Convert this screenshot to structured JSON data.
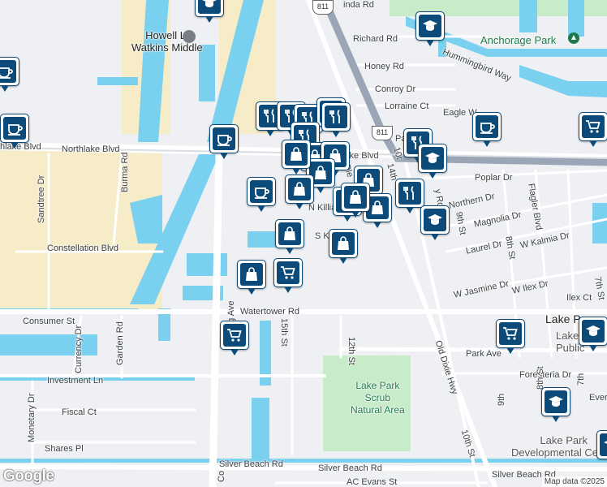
{
  "map": {
    "attribution": "Map data ©2025",
    "logo": "Google",
    "route_shield": "811",
    "colors": {
      "water": "#7ad0ef",
      "park": "#c8ebc9",
      "road": "#ffffff",
      "highway": "#9aa6b5",
      "pin": "#0b4a79",
      "sand": "#f6ecc8"
    }
  },
  "streets": [
    {
      "key": "richard",
      "text": "Richard Rd"
    },
    {
      "key": "honey",
      "text": "Honey Rd"
    },
    {
      "key": "conroy",
      "text": "Conroy Dr"
    },
    {
      "key": "lorraine",
      "text": "Lorraine Ct"
    },
    {
      "key": "eagle",
      "text": "Eagle W"
    },
    {
      "key": "hummingbird",
      "text": "Hummingbird Way"
    },
    {
      "key": "northlake_w",
      "text": "hlake Blvd"
    },
    {
      "key": "northlake_c",
      "text": "Northlake Blvd"
    },
    {
      "key": "northlake_e",
      "text": "lake Blvd"
    },
    {
      "key": "poplar",
      "text": "Poplar Dr"
    },
    {
      "key": "northern",
      "text": "Northern Dr"
    },
    {
      "key": "magnolia",
      "text": "Magnolia Dr"
    },
    {
      "key": "laurel",
      "text": "Laurel Dr"
    },
    {
      "key": "kalmia",
      "text": "W Kalmia Dr"
    },
    {
      "key": "jasmine",
      "text": "W Jasmine Dr"
    },
    {
      "key": "ilex",
      "text": "W Ilex Dr"
    },
    {
      "key": "ilexct",
      "text": "Ilex Ct"
    },
    {
      "key": "killian",
      "text": "N Killia"
    },
    {
      "key": "sk",
      "text": "S K"
    },
    {
      "key": "constellation",
      "text": "Constellation Blvd"
    },
    {
      "key": "consumer",
      "text": "Consumer St"
    },
    {
      "key": "watertower",
      "text": "Watertower Rd"
    },
    {
      "key": "investment",
      "text": "Investment Ln"
    },
    {
      "key": "fiscal",
      "text": "Fiscal Ct"
    },
    {
      "key": "shares",
      "text": "Shares Pl"
    },
    {
      "key": "silver_w",
      "text": "Silver Beach Rd"
    },
    {
      "key": "silver_c",
      "text": "Silver Beach Rd"
    },
    {
      "key": "silver_e",
      "text": "Silver Beach Rd"
    },
    {
      "key": "acevans",
      "text": "AC Evans St"
    },
    {
      "key": "park",
      "text": "Park Ave"
    },
    {
      "key": "foresteria",
      "text": "Foresteria Dr"
    },
    {
      "key": "sandtree",
      "text": "Sandtree Dr"
    },
    {
      "key": "burma",
      "text": "Burma Rd"
    },
    {
      "key": "currency",
      "text": "Currency Dr"
    },
    {
      "key": "garden",
      "text": "Garden Rd"
    },
    {
      "key": "monetary",
      "text": "Monetary Dr"
    },
    {
      "key": "cong",
      "text": "Cong Ave"
    },
    {
      "key": "cong2",
      "text": "Co"
    },
    {
      "key": "fifteenth",
      "text": "15th St"
    },
    {
      "key": "twelfth",
      "text": "12th St"
    },
    {
      "key": "olddixie",
      "text": "Old Dixie Hwy"
    },
    {
      "key": "tenth",
      "text": "10th St"
    },
    {
      "key": "ninth",
      "text": "9th St"
    },
    {
      "key": "eighth",
      "text": "8th St"
    },
    {
      "key": "flagler",
      "text": "Flagler Blvd"
    },
    {
      "key": "seventh",
      "text": "7th St"
    },
    {
      "key": "nine2",
      "text": "9th"
    },
    {
      "key": "eight2",
      "text": "8th St"
    },
    {
      "key": "seven2",
      "text": "7th"
    },
    {
      "key": "inda",
      "text": "inda Rd"
    },
    {
      "key": "pa",
      "text": "Pa"
    },
    {
      "key": "ole",
      "text": "Ole"
    },
    {
      "key": "tenth2",
      "text": "10t"
    },
    {
      "key": "st14",
      "text": "14th"
    },
    {
      "key": "evers",
      "text": "Ever"
    },
    {
      "key": "yrd",
      "text": "y Rd"
    }
  ],
  "places": [
    {
      "key": "watkins",
      "text": "Howell L.\nWatkins Middle"
    },
    {
      "key": "anchorage",
      "text": "Anchorage Park"
    },
    {
      "key": "scrub",
      "text": "Lake Park\nScrub\nNatural Area"
    },
    {
      "key": "lakepark",
      "text": "Lake P"
    },
    {
      "key": "library",
      "text": "Lake\nPublic"
    },
    {
      "key": "devcenter",
      "text": "Lake Park\nDevelopmental Center"
    }
  ],
  "markers": [
    {
      "type": "coffee"
    },
    {
      "type": "school"
    },
    {
      "type": "school"
    },
    {
      "type": "coffee"
    },
    {
      "type": "cart"
    },
    {
      "type": "coffee"
    },
    {
      "type": "restaurant"
    },
    {
      "type": "restaurant"
    },
    {
      "type": "restaurant"
    },
    {
      "type": "restaurant"
    },
    {
      "type": "restaurant"
    },
    {
      "type": "restaurant"
    },
    {
      "type": "restaurant"
    },
    {
      "type": "school"
    },
    {
      "type": "coffee"
    },
    {
      "type": "bag"
    },
    {
      "type": "bag"
    },
    {
      "type": "bag"
    },
    {
      "type": "bag"
    },
    {
      "type": "bag"
    },
    {
      "type": "coffee"
    },
    {
      "type": "bag"
    },
    {
      "type": "bag"
    },
    {
      "type": "bag"
    },
    {
      "type": "restaurant"
    },
    {
      "type": "school"
    },
    {
      "type": "bag"
    },
    {
      "type": "bag"
    },
    {
      "type": "bag"
    },
    {
      "type": "cart"
    },
    {
      "type": "cart"
    },
    {
      "type": "cart"
    },
    {
      "type": "school"
    },
    {
      "type": "school"
    },
    {
      "type": "school"
    },
    {
      "type": "bag"
    }
  ]
}
